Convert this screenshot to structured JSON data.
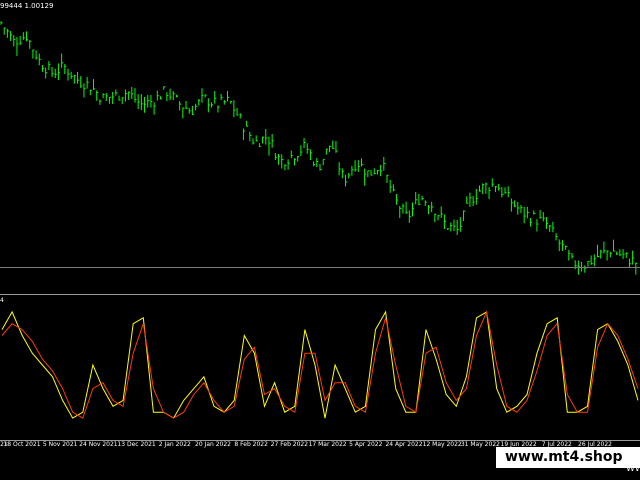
{
  "header": {
    "price_info": "99444 1.00129",
    "indicator_label": "4"
  },
  "dates": [
    "21",
    "18 Oct 2021",
    "5 Nov 2021",
    "24 Nov 2021",
    "13 Dec 2021",
    "2 Jan 2022",
    "20 Jan 2022",
    "8 Feb 2022",
    "27 Feb 2022",
    "17 Mar 2022",
    "5 Apr 2022",
    "24 Apr 2022",
    "12 May 2022",
    "31 May 2022",
    "19 Jun 2022",
    "7 Jul 2022",
    "26 Jul 2022"
  ],
  "watermark": {
    "text": "www.mt4.shop",
    "tail": "WW"
  },
  "colors": {
    "background": "#000000",
    "price_bars": "#00ff00",
    "stoch_main": "#ffff00",
    "stoch_signal": "#ff3b00"
  },
  "chart_data": {
    "type": "line",
    "series": [
      {
        "values": [
          0.8,
          0.95,
          0.75,
          0.6,
          0.5,
          0.4,
          0.2,
          0.05,
          0.1,
          0.5,
          0.3,
          0.15,
          0.2,
          0.85,
          0.9,
          0.1,
          0.1,
          0.05,
          0.2,
          0.3,
          0.4,
          0.15,
          0.1,
          0.2,
          0.75,
          0.6,
          0.15,
          0.35,
          0.1,
          0.15,
          0.8,
          0.5,
          0.05,
          0.5,
          0.3,
          0.1,
          0.15,
          0.8,
          0.95,
          0.3,
          0.1,
          0.1,
          0.8,
          0.55,
          0.25,
          0.15,
          0.4,
          0.9,
          0.95,
          0.3,
          0.1,
          0.15,
          0.25,
          0.6,
          0.85,
          0.9,
          0.1,
          0.1,
          0.15,
          0.8,
          0.85,
          0.7,
          0.5,
          0.2
        ]
      },
      {
        "values": [
          0.75,
          0.85,
          0.8,
          0.7,
          0.55,
          0.45,
          0.3,
          0.1,
          0.05,
          0.3,
          0.35,
          0.2,
          0.15,
          0.6,
          0.85,
          0.3,
          0.1,
          0.05,
          0.1,
          0.25,
          0.35,
          0.2,
          0.1,
          0.15,
          0.55,
          0.65,
          0.25,
          0.3,
          0.15,
          0.1,
          0.6,
          0.6,
          0.2,
          0.35,
          0.35,
          0.15,
          0.1,
          0.6,
          0.9,
          0.5,
          0.15,
          0.1,
          0.6,
          0.65,
          0.35,
          0.2,
          0.3,
          0.75,
          0.95,
          0.5,
          0.15,
          0.1,
          0.2,
          0.45,
          0.75,
          0.85,
          0.25,
          0.1,
          0.1,
          0.65,
          0.85,
          0.75,
          0.55,
          0.3
        ]
      }
    ],
    "ylim": [
      0,
      1
    ],
    "price_closes": [
      1.0,
      0.985,
      0.99,
      0.97,
      0.96,
      0.965,
      0.955,
      0.95,
      0.94,
      0.942,
      0.945,
      0.935,
      0.938,
      0.946,
      0.936,
      0.93,
      0.94,
      0.935,
      0.938,
      0.92,
      0.905,
      0.91,
      0.89,
      0.895,
      0.902,
      0.885,
      0.905,
      0.875,
      0.89,
      0.88,
      0.888,
      0.86,
      0.845,
      0.862,
      0.855,
      0.84,
      0.835,
      0.86,
      0.87,
      0.872,
      0.86,
      0.85,
      0.845,
      0.84,
      0.825,
      0.81,
      0.808,
      0.815,
      0.82,
      0.815,
      0.81
    ]
  }
}
